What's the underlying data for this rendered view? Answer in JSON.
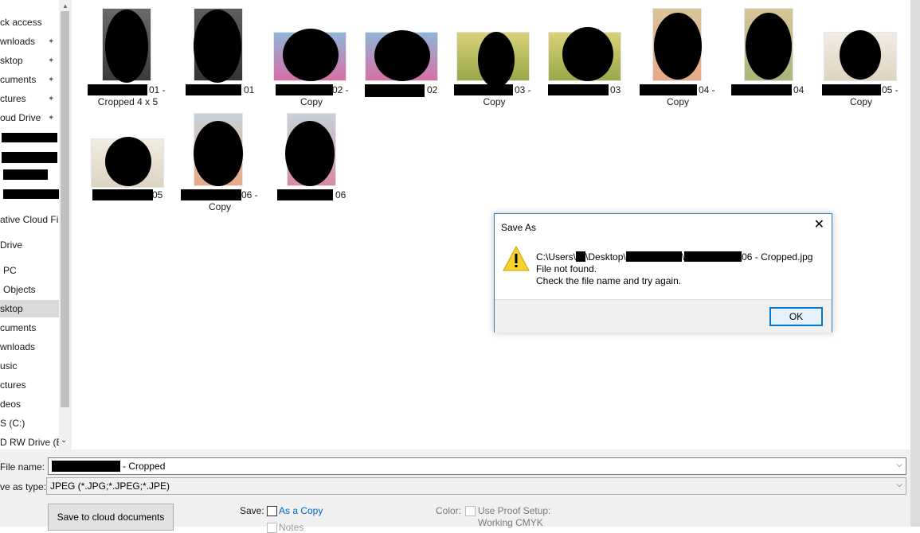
{
  "sidebar": {
    "items": [
      {
        "label": "ck access",
        "pinned": false
      },
      {
        "label": "wnloads",
        "pinned": true
      },
      {
        "label": "sktop",
        "pinned": true
      },
      {
        "label": "cuments",
        "pinned": true
      },
      {
        "label": "ctures",
        "pinned": true
      },
      {
        "label": "oud Drive",
        "pinned": true
      },
      {
        "label": "ative Cloud Fil",
        "pinned": false
      },
      {
        "label": "Drive",
        "pinned": false
      },
      {
        "label": "PC",
        "pinned": false
      },
      {
        "label": "Objects",
        "pinned": false
      },
      {
        "label": "sktop",
        "pinned": false,
        "selected": true
      },
      {
        "label": "cuments",
        "pinned": false
      },
      {
        "label": "wnloads",
        "pinned": false
      },
      {
        "label": "usic",
        "pinned": false
      },
      {
        "label": "ctures",
        "pinned": false
      },
      {
        "label": "deos",
        "pinned": false
      },
      {
        "label": "S (C:)",
        "pinned": false
      },
      {
        "label": "D RW Drive (E",
        "pinned": false
      }
    ]
  },
  "files": [
    {
      "line1": "01 -",
      "line2": "Cropped 4 x 5"
    },
    {
      "line1": "01",
      "line2": ""
    },
    {
      "line1": "02 -",
      "line2": "Copy"
    },
    {
      "line1": "02",
      "line2": ""
    },
    {
      "line1": "03 -",
      "line2": "Copy"
    },
    {
      "line1": "03",
      "line2": ""
    },
    {
      "line1": "04 -",
      "line2": "Copy"
    },
    {
      "line1": "04",
      "line2": ""
    },
    {
      "line1": "05 -",
      "line2": "Copy"
    },
    {
      "line1": "05",
      "line2": ""
    },
    {
      "line1": "06 -",
      "line2": "Copy"
    },
    {
      "line1": "06",
      "line2": ""
    }
  ],
  "bottom": {
    "filename_label": "File name:",
    "filename_value": "- Cropped",
    "savetype_label": "ve as type:",
    "savetype_value": "JPEG (*.JPG;*.JPEG;*.JPE)",
    "cloud_button": "Save to cloud documents",
    "save_label": "Save:",
    "as_copy": "As a Copy",
    "notes": "Notes",
    "color_label": "Color:",
    "proof_setup": "Use Proof Setup:",
    "proof_value": "Working CMYK"
  },
  "dialog": {
    "title": "Save As",
    "path_prefix": "C:\\Users\\",
    "path_desktop": "\\Desktop\\",
    "path_sep": "\\",
    "path_suffix": "06 - Cropped.jpg",
    "line2": "File not found.",
    "line3": "Check the file name and try again.",
    "ok": "OK",
    "warning_glyph": "!",
    "close_glyph": "✕"
  },
  "icons": {
    "pin": "pin-icon",
    "warning": "warning-icon",
    "close": "close-icon",
    "chevron": "chevron-down-icon"
  },
  "colors": {
    "selection": "#d9d9d9",
    "dialog_border": "#3c7fb1",
    "ok_border": "#0078d7",
    "link_blue": "#0066cc",
    "warning_yellow": "#f8d22b"
  }
}
